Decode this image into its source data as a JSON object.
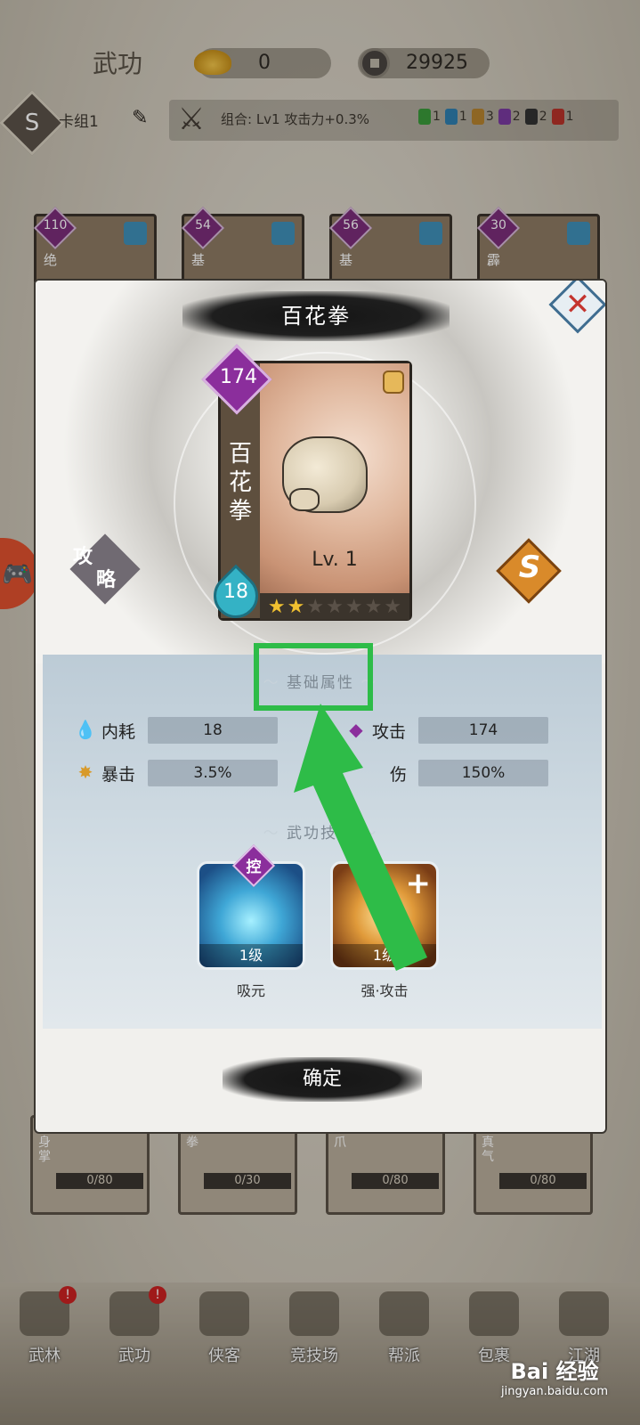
{
  "topbar": {
    "title": "武功",
    "gold": "0",
    "coins": "29925"
  },
  "deckbar": {
    "deck_icon": "S",
    "deck_name": "卡组1",
    "combo_text": "组合: Lv1 攻击力+0.3%",
    "mini_stats": [
      {
        "count": "1",
        "color": "#3a9a3a"
      },
      {
        "count": "1",
        "color": "#2f7fb0"
      },
      {
        "count": "3",
        "color": "#b7832f"
      },
      {
        "count": "2",
        "color": "#7a3aa0"
      },
      {
        "count": "2",
        "color": "#333333"
      },
      {
        "count": "1",
        "color": "#b8332a"
      }
    ]
  },
  "bg_cards": [
    {
      "level": "110",
      "name": "绝"
    },
    {
      "level": "54",
      "name": "基"
    },
    {
      "level": "56",
      "name": "基"
    },
    {
      "level": "30",
      "name": "霹"
    }
  ],
  "bg_cards_bottom": [
    {
      "name": "游身掌",
      "progress": "0/80"
    },
    {
      "name": "花拳",
      "progress": "0/30"
    },
    {
      "name": "毒爪",
      "progress": "0/80"
    },
    {
      "name": "吸真气",
      "progress": "0/80"
    }
  ],
  "nav": [
    {
      "label": "武林",
      "badge": "!"
    },
    {
      "label": "武功",
      "badge": "!"
    },
    {
      "label": "侠客",
      "badge": ""
    },
    {
      "label": "竞技场",
      "badge": ""
    },
    {
      "label": "帮派",
      "badge": ""
    },
    {
      "label": "包裹",
      "badge": ""
    },
    {
      "label": "江湖",
      "badge": ""
    }
  ],
  "modal": {
    "title": "百花拳",
    "close_label": "✕",
    "card": {
      "attack": "174",
      "name_chars": [
        "百",
        "花",
        "拳"
      ],
      "level": "Lv. 1",
      "mp": "18",
      "stars_total": 7,
      "stars_filled": 2
    },
    "strategy_line1": "攻",
    "strategy_line2": "略",
    "rank": "S",
    "base_attr_header": "基础属性",
    "stats": {
      "mp_label": "内耗",
      "mp_value": "18",
      "atk_label": "攻击",
      "atk_value": "174",
      "crit_label": "暴击",
      "crit_value": "3.5%",
      "critdmg_label": "伤",
      "critdmg_value": "150%"
    },
    "skills_header": "武功技能",
    "skills": [
      {
        "name": "吸元",
        "level": "1级",
        "badge": "控"
      },
      {
        "name": "强·攻击",
        "level": "1级",
        "badge": ""
      }
    ],
    "confirm_label": "确定"
  },
  "watermark": {
    "logo": "Bai 经验",
    "site": "jingyan.baidu.com"
  },
  "colors": {
    "highlight": "#2ebc48",
    "attack_purple": "#8b2e9c",
    "mp_cyan": "#34b2c5"
  }
}
